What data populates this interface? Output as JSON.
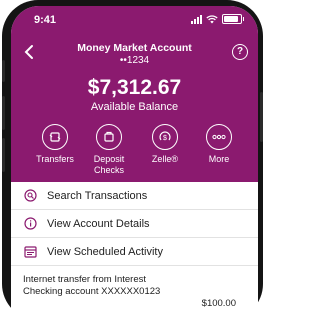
{
  "status_bar": {
    "time": "9:41"
  },
  "header": {
    "account_name": "Money Market Account",
    "account_number": "••1234",
    "balance": "$7,312.67",
    "balance_label": "Available Balance",
    "help_label": "?",
    "accent_color": "#8b1a6f"
  },
  "actions": [
    {
      "label": "Transfers",
      "icon": "transfer-icon"
    },
    {
      "label": "Deposit Checks",
      "icon": "deposit-check-icon"
    },
    {
      "label": "Zelle®",
      "icon": "zelle-icon"
    },
    {
      "label": "More",
      "icon": "more-icon"
    }
  ],
  "menu": [
    {
      "label": "Search Transactions",
      "icon": "search-icon"
    },
    {
      "label": "View Account Details",
      "icon": "info-icon"
    },
    {
      "label": "View Scheduled Activity",
      "icon": "calendar-icon"
    }
  ],
  "transactions": [
    {
      "description": "Internet transfer from Interest Checking account XXXXXX0123",
      "amount": "$100.00"
    }
  ]
}
